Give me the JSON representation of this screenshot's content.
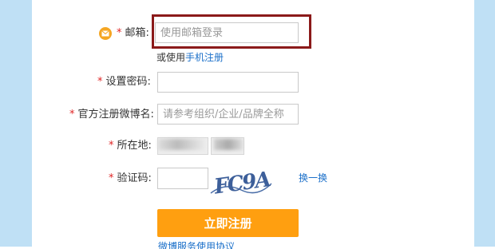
{
  "form": {
    "email": {
      "label": "邮箱:",
      "required": "*",
      "placeholder": "使用邮箱登录",
      "alt_prefix": "或使用",
      "alt_link": "手机注册"
    },
    "password": {
      "label": "设置密码:",
      "required": "*"
    },
    "weibo_name": {
      "label": "官方注册微博名:",
      "required": "*",
      "placeholder": "请参考组织/企业/品牌全称"
    },
    "location": {
      "label": "所在地:",
      "required": "*"
    },
    "captcha": {
      "label": "验证码:",
      "required": "*",
      "image_text": "FC9A",
      "refresh_label": "换一换"
    },
    "submit_label": "立即注册",
    "bottom_link": "微博服务使用协议"
  },
  "colors": {
    "accent": "#ff9f10",
    "highlight_border": "#8b1a1a",
    "link": "#1a6fc9",
    "side": "#bfe0f5"
  },
  "icons": {
    "email": "mail-icon"
  }
}
